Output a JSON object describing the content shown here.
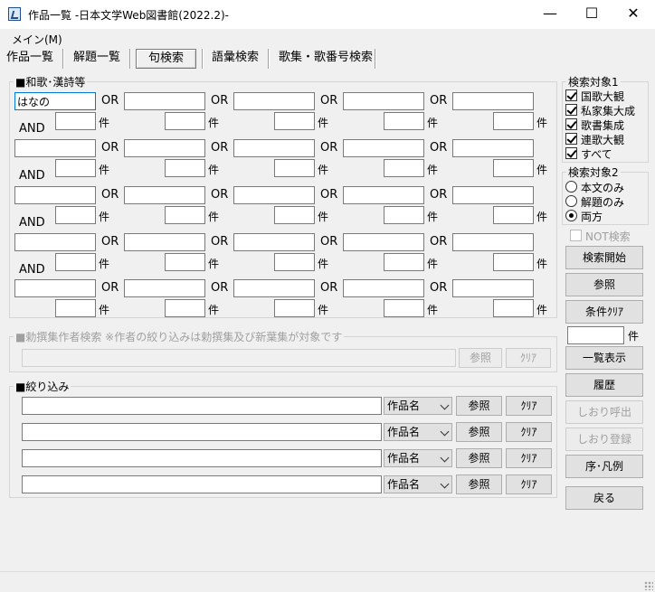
{
  "window": {
    "title": "作品一覧 -日本文学Web図書館(2022.2)-",
    "minimize": "—",
    "maximize": "☐",
    "close": "✕"
  },
  "menu": {
    "main": "メイン(M)"
  },
  "tabs": [
    {
      "label": "作品一覧"
    },
    {
      "label": "解題一覧"
    },
    {
      "label": "句検索"
    },
    {
      "label": "語彙検索"
    },
    {
      "label": "歌集・歌番号検索"
    }
  ],
  "waka": {
    "group_label": "■和歌･漢詩等",
    "or_label": "OR",
    "and_label": "AND",
    "count_unit": "件",
    "first_value": "はなの"
  },
  "author": {
    "group_label": "■勅撰集作者検索 ※作者の絞り込みは勅撰集及び新葉集が対象です",
    "ref_label": "参照",
    "clear_label": "ｸﾘｱ"
  },
  "filter": {
    "group_label": "■絞り込み",
    "rows": [
      {
        "select": "作品名",
        "ref": "参照",
        "clear": "ｸﾘｱ"
      },
      {
        "select": "作品名",
        "ref": "参照",
        "clear": "ｸﾘｱ"
      },
      {
        "select": "作品名",
        "ref": "参照",
        "clear": "ｸﾘｱ"
      },
      {
        "select": "作品名",
        "ref": "参照",
        "clear": "ｸﾘｱ"
      }
    ]
  },
  "target1": {
    "label": "検索対象1",
    "items": [
      {
        "label": "国歌大観",
        "checked": true
      },
      {
        "label": "私家集大成",
        "checked": true
      },
      {
        "label": "歌書集成",
        "checked": true
      },
      {
        "label": "連歌大観",
        "checked": true
      },
      {
        "label": "すべて",
        "checked": true
      }
    ]
  },
  "target2": {
    "label": "検索対象2",
    "items": [
      {
        "label": "本文のみ",
        "selected": false
      },
      {
        "label": "解題のみ",
        "selected": false
      },
      {
        "label": "両方",
        "selected": true
      }
    ]
  },
  "not_search": "NOT検索",
  "buttons": {
    "start": "検索開始",
    "ref": "参照",
    "clear_cond": "条件ｸﾘｱ",
    "count_unit": "件",
    "list_view": "一覧表示",
    "history": "履歴",
    "bookmark_call": "しおり呼出",
    "bookmark_save": "しおり登録",
    "legend": "序･凡例",
    "back": "戻る"
  }
}
